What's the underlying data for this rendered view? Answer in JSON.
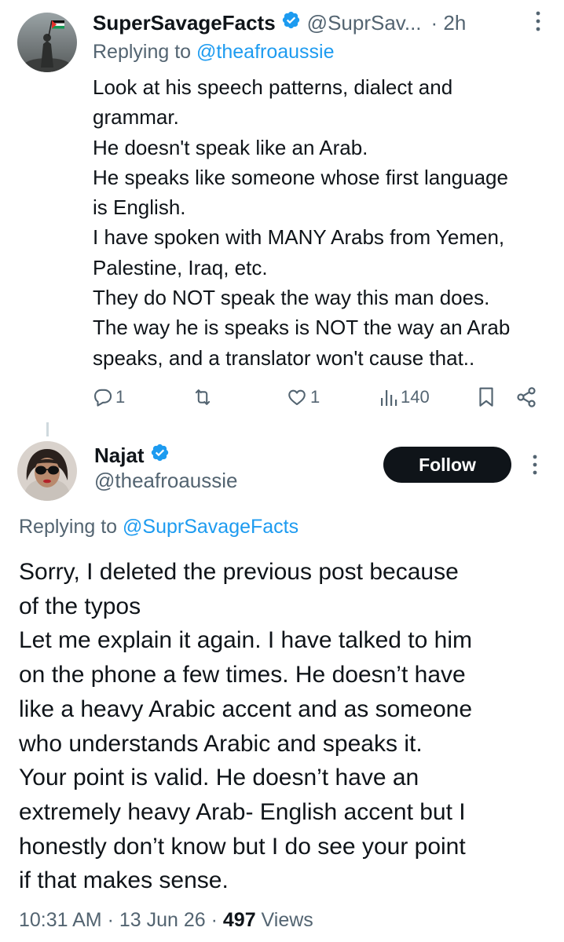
{
  "reply_tweet": {
    "display_name": "SuperSavageFacts",
    "handle": "@SuprSav...",
    "time": "· 2h",
    "replying_prefix": "Replying to ",
    "replying_to": "@theafroaussie",
    "body_lines": [
      "Look at his speech patterns, dialect and",
      "grammar.",
      "He doesn't speak like an Arab.",
      "He speaks like someone whose first language",
      "is English.",
      "I have spoken with MANY Arabs from Yemen,",
      "Palestine, Iraq, etc.",
      "They do NOT speak the way this man does.",
      "The way he is speaks is NOT the way an Arab",
      "speaks, and a translator won't cause that.."
    ],
    "actions": {
      "replies": "1",
      "reposts": "",
      "likes": "1",
      "views": "140"
    }
  },
  "main_tweet": {
    "display_name": "Najat",
    "handle": "@theafroaussie",
    "follow_label": "Follow",
    "replying_prefix": "Replying to ",
    "replying_to": "@SuprSavageFacts",
    "body_lines": [
      "Sorry, I deleted the previous post because",
      "of the typos",
      "Let me explain it again. I have talked to him",
      "on the phone a few times. He doesn’t have",
      "like a heavy Arabic accent and as someone",
      "who understands Arabic and speaks it.",
      "Your point is valid. He doesn’t have an",
      "extremely heavy Arab- English accent but I",
      "honestly don’t know but I do see your point",
      "if that makes sense."
    ],
    "timestamp": "10:31 AM · 13 Jun 26 · ",
    "views_count": "497",
    "views_label": " Views"
  },
  "colors": {
    "text_primary": "#0f1419",
    "text_secondary": "#536471",
    "link": "#1d9bf0",
    "verified_badge": "#1d9bf0",
    "follow_button_bg": "#0f1419"
  },
  "icons": {
    "reply": "speech-bubble-icon",
    "repost": "repost-arrows-icon",
    "like": "heart-icon",
    "views": "bar-chart-icon",
    "bookmark": "bookmark-icon",
    "share": "share-icon",
    "more": "vertical-dots-icon",
    "verified": "verified-badge-icon"
  }
}
